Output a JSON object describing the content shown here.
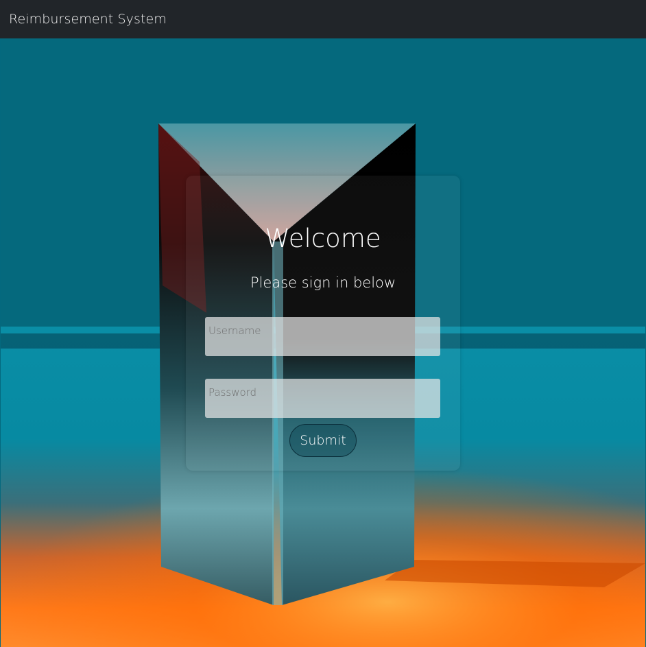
{
  "navbar": {
    "brand": "Reimbursement System"
  },
  "login": {
    "title": "Welcome",
    "subtitle": "Please sign in below",
    "username_placeholder": "Username",
    "username_value": "",
    "password_placeholder": "Password",
    "password_value": "",
    "submit_label": "Submit"
  },
  "background": {
    "description": "crystal-prism-photo",
    "colors": {
      "backdrop_teal": "#05697d",
      "floor_orange": "#ff6a00",
      "prism_dark": "#000000"
    }
  },
  "colors": {
    "navbar_bg": "#212529",
    "brand_text": "#f1f1f1",
    "input_bg": "#e6e6e6",
    "button_border": "#0b2f3b"
  }
}
